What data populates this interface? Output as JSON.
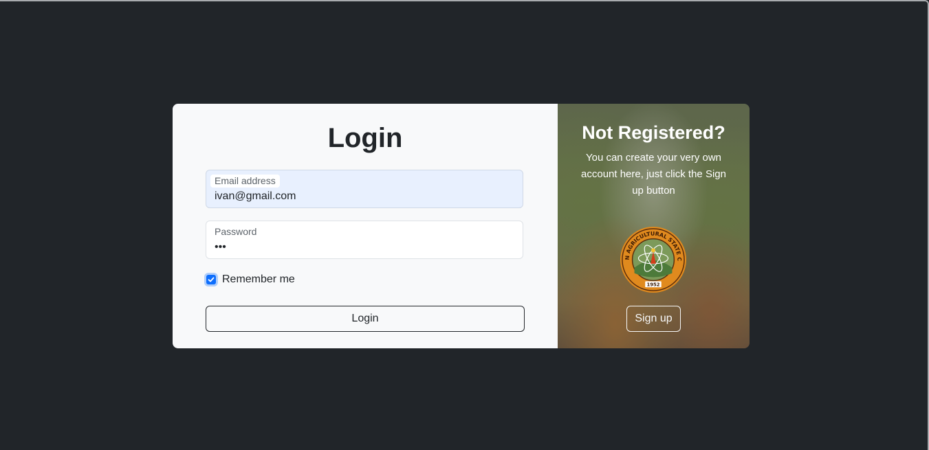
{
  "login": {
    "title": "Login",
    "email": {
      "label": "Email address",
      "value": "ivan@gmail.com"
    },
    "password": {
      "label": "Password",
      "value": "•••"
    },
    "remember": {
      "label": "Remember me",
      "checked": true
    },
    "submit_label": "Login"
  },
  "signup_panel": {
    "title": "Not Registered?",
    "text": "You can create your very own account here, just click the Sign up button",
    "seal": {
      "name": "college-seal-logo",
      "text_top": "BULACAN AGRICULTURAL STATE COLLEGE",
      "year": "1952"
    },
    "button_label": "Sign up"
  },
  "colors": {
    "page_bg": "#212529",
    "card_bg": "#f8f9fa",
    "email_autofill_bg": "#e8f0fe",
    "checkbox_accent": "#0d6efd",
    "text_dark": "#212529"
  }
}
